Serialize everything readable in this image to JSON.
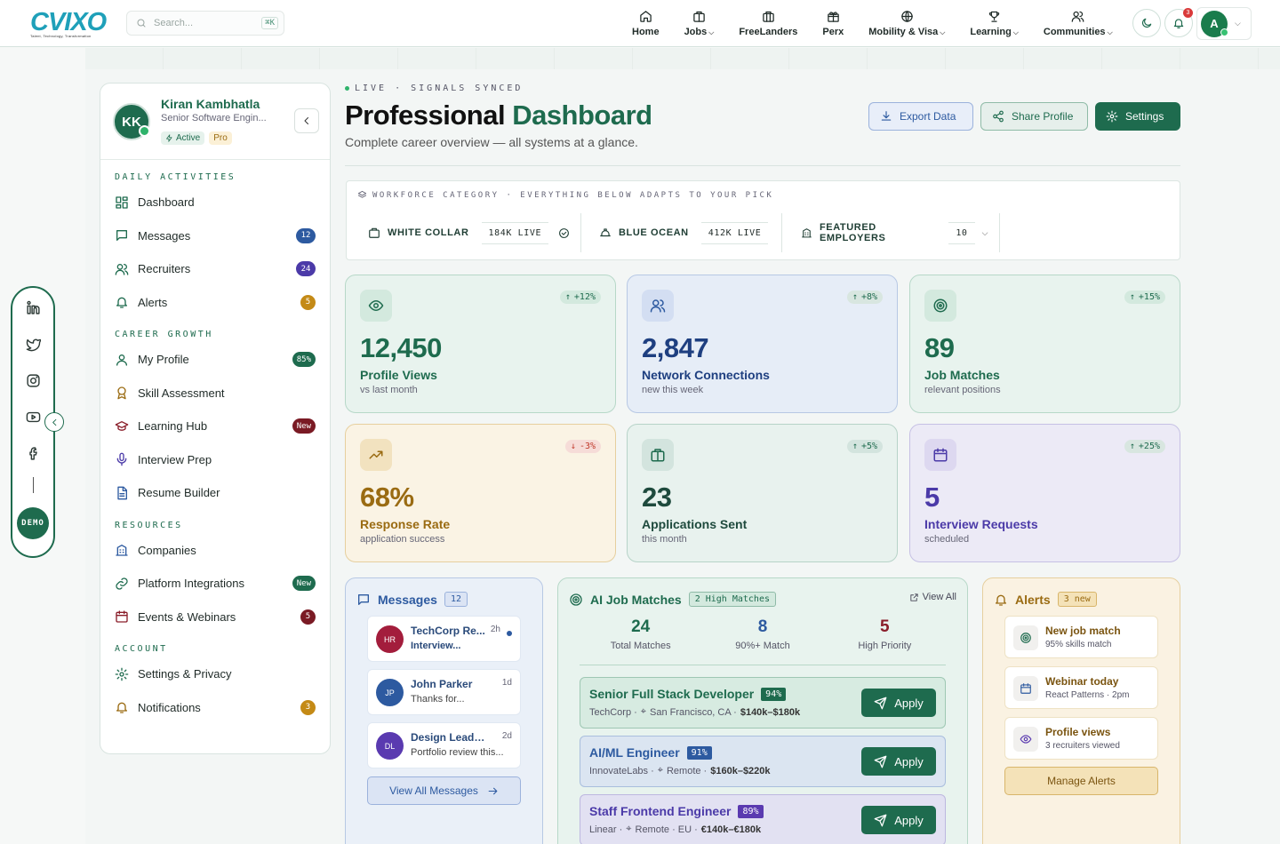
{
  "brand": {
    "logo_text": "CVIXO",
    "tagline": "Talent, Technology, Transformation"
  },
  "search": {
    "placeholder": "Search...",
    "shortcut": "⌘K"
  },
  "nav": {
    "items": [
      {
        "label": "Home"
      },
      {
        "label": "Jobs",
        "has_menu": true
      },
      {
        "label": "FreeLanders"
      },
      {
        "label": "Perx"
      },
      {
        "label": "Mobility & Visa",
        "has_menu": true
      },
      {
        "label": "Learning",
        "has_menu": true
      },
      {
        "label": "Communities",
        "has_menu": true
      }
    ],
    "notifications_count": "3",
    "avatar_initial": "A"
  },
  "profile": {
    "initials": "KK",
    "name": "Kiran Kambhatla",
    "title": "Senior Software Engin...",
    "status": "Active",
    "plan": "Pro"
  },
  "sidebar": {
    "sections": [
      {
        "title": "DAILY ACTIVITIES",
        "items": [
          {
            "label": "Dashboard"
          },
          {
            "label": "Messages",
            "count": "12"
          },
          {
            "label": "Recruiters",
            "count": "24"
          },
          {
            "label": "Alerts",
            "count": "5"
          }
        ]
      },
      {
        "title": "CAREER GROWTH",
        "items": [
          {
            "label": "My Profile",
            "count": "85%"
          },
          {
            "label": "Skill Assessment"
          },
          {
            "label": "Learning Hub",
            "count": "New"
          },
          {
            "label": "Interview Prep"
          },
          {
            "label": "Resume Builder"
          }
        ]
      },
      {
        "title": "RESOURCES",
        "items": [
          {
            "label": "Companies"
          },
          {
            "label": "Platform Integrations",
            "count": "New"
          },
          {
            "label": "Events & Webinars",
            "count": "5"
          }
        ]
      },
      {
        "title": "ACCOUNT",
        "items": [
          {
            "label": "Settings & Privacy"
          },
          {
            "label": "Notifications",
            "count": "3"
          }
        ]
      }
    ]
  },
  "rail": {
    "demo_label": "DEMO"
  },
  "header": {
    "status": "LIVE · SIGNALS SYNCED",
    "title_a": "Professional",
    "title_b": "Dashboard",
    "subtitle": "Complete career overview — all systems at a glance.",
    "export_label": "Export Data",
    "share_label": "Share Profile",
    "settings_label": "Settings"
  },
  "categories": {
    "label": "WORKFORCE CATEGORY · EVERYTHING BELOW ADAPTS TO YOUR PICK",
    "items": [
      {
        "label": "WHITE COLLAR",
        "value": "184K LIVE"
      },
      {
        "label": "BLUE OCEAN",
        "value": "412K LIVE"
      },
      {
        "label": "FEATURED EMPLOYERS",
        "value": "10"
      }
    ]
  },
  "stats": [
    {
      "value": "12,450",
      "label": "Profile Views",
      "sub": "vs last month",
      "change": "+12%",
      "direction": "up"
    },
    {
      "value": "2,847",
      "label": "Network Connections",
      "sub": "new this week",
      "change": "+8%",
      "direction": "up"
    },
    {
      "value": "89",
      "label": "Job Matches",
      "sub": "relevant positions",
      "change": "+15%",
      "direction": "up"
    },
    {
      "value": "68%",
      "label": "Response Rate",
      "sub": "application success",
      "change": "-3%",
      "direction": "down"
    },
    {
      "value": "23",
      "label": "Applications Sent",
      "sub": "this month",
      "change": "+5%",
      "direction": "up"
    },
    {
      "value": "5",
      "label": "Interview Requests",
      "sub": "scheduled",
      "change": "+25%",
      "direction": "up"
    }
  ],
  "messages": {
    "title": "Messages",
    "count": "12",
    "items": [
      {
        "initials": "HR",
        "name": "TechCorp Re...",
        "time": "2h",
        "preview": "Interview...",
        "unread": true
      },
      {
        "initials": "JP",
        "name": "John Parker",
        "time": "1d",
        "preview": "Thanks for..."
      },
      {
        "initials": "DL",
        "name": "Design Lead · A...",
        "time": "2d",
        "preview": "Portfolio review this..."
      }
    ],
    "view_all": "View All Messages"
  },
  "jobs": {
    "title": "AI Job Matches",
    "pill": "2 High Matches",
    "view_all": "View All",
    "summary": [
      {
        "value": "24",
        "label": "Total Matches"
      },
      {
        "value": "8",
        "label": "90%+ Match"
      },
      {
        "value": "5",
        "label": "High Priority"
      }
    ],
    "items": [
      {
        "title": "Senior Full Stack Developer",
        "match": "94%",
        "company": "TechCorp ·",
        "location": "San Francisco, CA ·",
        "salary": "$140k–$180k",
        "apply": "Apply"
      },
      {
        "title": "AI/ML Engineer",
        "match": "91%",
        "company": "InnovateLabs ·",
        "location": "Remote ·",
        "salary": "$160k–$220k",
        "apply": "Apply"
      },
      {
        "title": "Staff Frontend Engineer",
        "match": "89%",
        "company": "Linear ·",
        "location": "Remote · EU ·",
        "salary": "€140k–€180k",
        "apply": "Apply"
      }
    ]
  },
  "alerts": {
    "title": "Alerts",
    "pill": "3 new",
    "items": [
      {
        "title": "New job match",
        "sub": "95% skills match"
      },
      {
        "title": "Webinar today",
        "sub": "React Patterns · 2pm"
      },
      {
        "title": "Profile views",
        "sub": "3 recruiters viewed"
      }
    ],
    "manage": "Manage Alerts"
  }
}
